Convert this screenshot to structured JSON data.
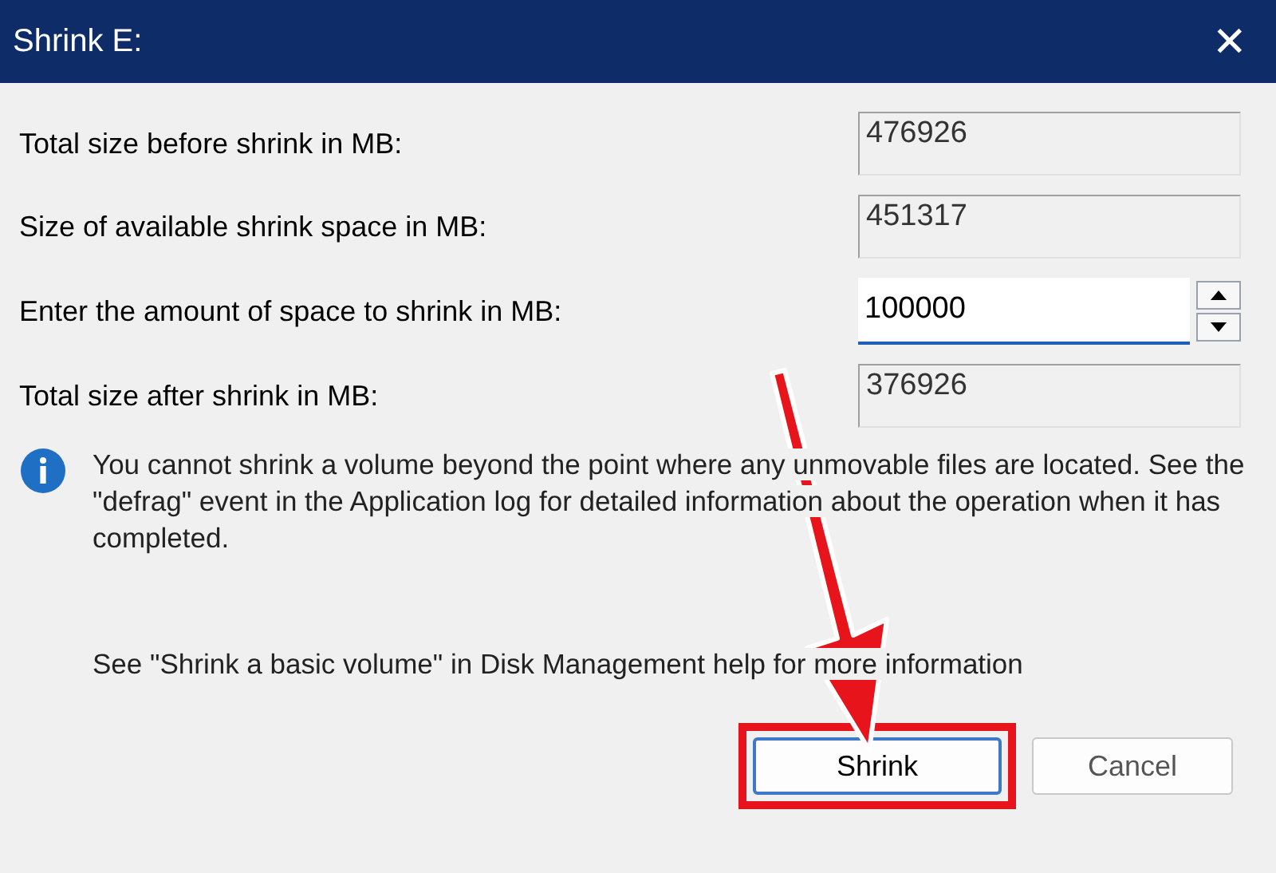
{
  "window": {
    "title": "Shrink E:",
    "close": "✕"
  },
  "fields": [
    {
      "label": "Total size before shrink in MB:",
      "value": "476926",
      "kind": "readonly"
    },
    {
      "label": "Size of available shrink space in MB:",
      "value": "451317",
      "kind": "readonly"
    },
    {
      "label": "Enter the amount of space to shrink in MB:",
      "value": "100000",
      "kind": "spin"
    },
    {
      "label": "Total size after shrink in MB:",
      "value": "376926",
      "kind": "readonly"
    }
  ],
  "info": {
    "text": "You cannot shrink a volume beyond the point where any unmovable files are located. See the \"defrag\" event in the Application log for detailed information about the operation when it has completed.",
    "help": "See \"Shrink a basic volume\" in Disk Management help for more information"
  },
  "buttons": [
    {
      "label": "Shrink",
      "highlighted": true
    },
    {
      "label": "Cancel",
      "highlighted": false
    }
  ]
}
